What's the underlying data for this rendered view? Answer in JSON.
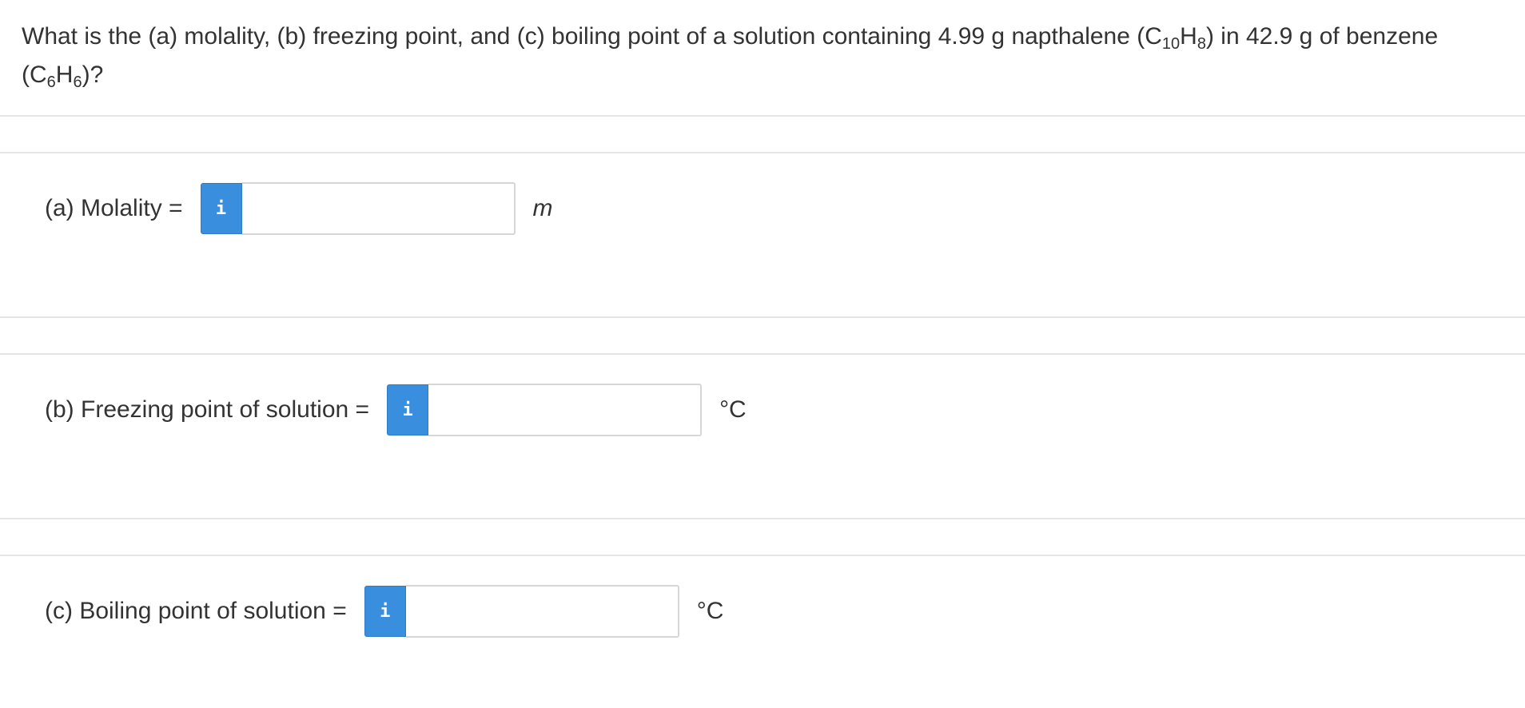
{
  "question": {
    "text_parts": [
      {
        "t": "What is the (a) molality, (b) freezing point, and (c) boiling point of a solution containing 4.99 g napthalene (C"
      },
      {
        "sub": "10"
      },
      {
        "t": "H"
      },
      {
        "sub": "8"
      },
      {
        "t": ") in 42.9 g of benzene (C"
      },
      {
        "sub": "6"
      },
      {
        "t": "H"
      },
      {
        "sub": "6"
      },
      {
        "t": ")?"
      }
    ]
  },
  "parts": [
    {
      "id": "a",
      "label": "(a) Molality =",
      "info_glyph": "i",
      "input_value": "",
      "unit": "m",
      "unit_italic": true
    },
    {
      "id": "b",
      "label": "(b) Freezing point of solution =",
      "info_glyph": "i",
      "input_value": "",
      "unit": "°C",
      "unit_italic": false
    },
    {
      "id": "c",
      "label": "(c) Boiling point of solution =",
      "info_glyph": "i",
      "input_value": "",
      "unit": "°C",
      "unit_italic": false
    }
  ],
  "colors": {
    "info_button": "#3a8ede",
    "divider": "#e4e4e4",
    "text": "#333333"
  }
}
